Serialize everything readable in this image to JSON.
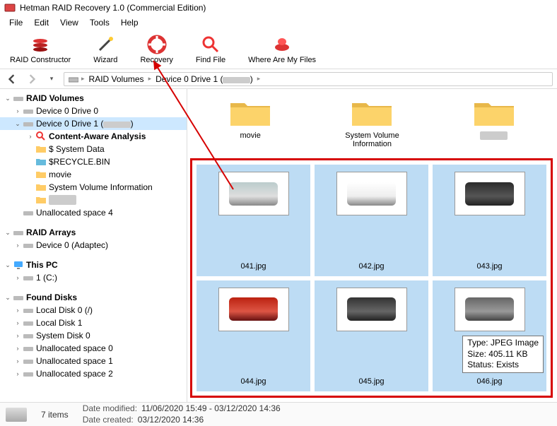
{
  "titlebar": {
    "app_title": "Hetman RAID Recovery 1.0 (Commercial Edition)"
  },
  "menubar": {
    "items": [
      "File",
      "Edit",
      "View",
      "Tools",
      "Help"
    ]
  },
  "toolbar": {
    "buttons": [
      {
        "label": "RAID Constructor",
        "icon": "disks"
      },
      {
        "label": "Wizard",
        "icon": "wand"
      },
      {
        "label": "Recovery",
        "icon": "lifering"
      },
      {
        "label": "Find File",
        "icon": "magnifier"
      },
      {
        "label": "Where Are My Files",
        "icon": "alarm"
      }
    ]
  },
  "breadcrumb": {
    "segments": [
      "RAID Volumes",
      "Device 0 Drive 1 ("
    ],
    "redacted_tail": ")"
  },
  "tree": {
    "raid_volumes": "RAID Volumes",
    "device0d0": "Device 0 Drive 0",
    "device0d1": "Device 0 Drive 1 (",
    "content_aware": "Content-Aware Analysis",
    "system_data": "$ System Data",
    "recycle": "$RECYCLE.BIN",
    "movie": "movie",
    "svi": "System Volume Information",
    "redacted_node": "",
    "unalloc4": "Unallocated space 4",
    "raid_arrays": "RAID Arrays",
    "device0_adaptec": "Device 0 (Adaptec)",
    "this_pc": "This PC",
    "drive_c": "1 (C:)",
    "found_disks": "Found Disks",
    "ld0": "Local Disk 0 (/)",
    "ld1": "Local Disk 1",
    "sd0": "System Disk 0",
    "uas0": "Unallocated space 0",
    "uas1": "Unallocated space 1",
    "uas2": "Unallocated space 2"
  },
  "folders_row": {
    "items": [
      "movie",
      "System Volume Information",
      ""
    ]
  },
  "thumbnails": {
    "items": [
      {
        "name": "041.jpg",
        "style": "car-white"
      },
      {
        "name": "042.jpg",
        "style": "car-suv"
      },
      {
        "name": "043.jpg",
        "style": "car-dark"
      },
      {
        "name": "044.jpg",
        "style": "car-red"
      },
      {
        "name": "045.jpg",
        "style": "car-dk2"
      },
      {
        "name": "046.jpg",
        "style": "car-gray"
      }
    ]
  },
  "tooltip": {
    "line1": "Type: JPEG Image",
    "line2": "Size: 405.11 KB",
    "line3": "Status: Exists"
  },
  "status": {
    "count": "7 items",
    "dm_label": "Date modified:",
    "dm_value": "11/06/2020 15:49 - 03/12/2020 14:36",
    "dc_label": "Date created:",
    "dc_value": "03/12/2020 14:36"
  }
}
